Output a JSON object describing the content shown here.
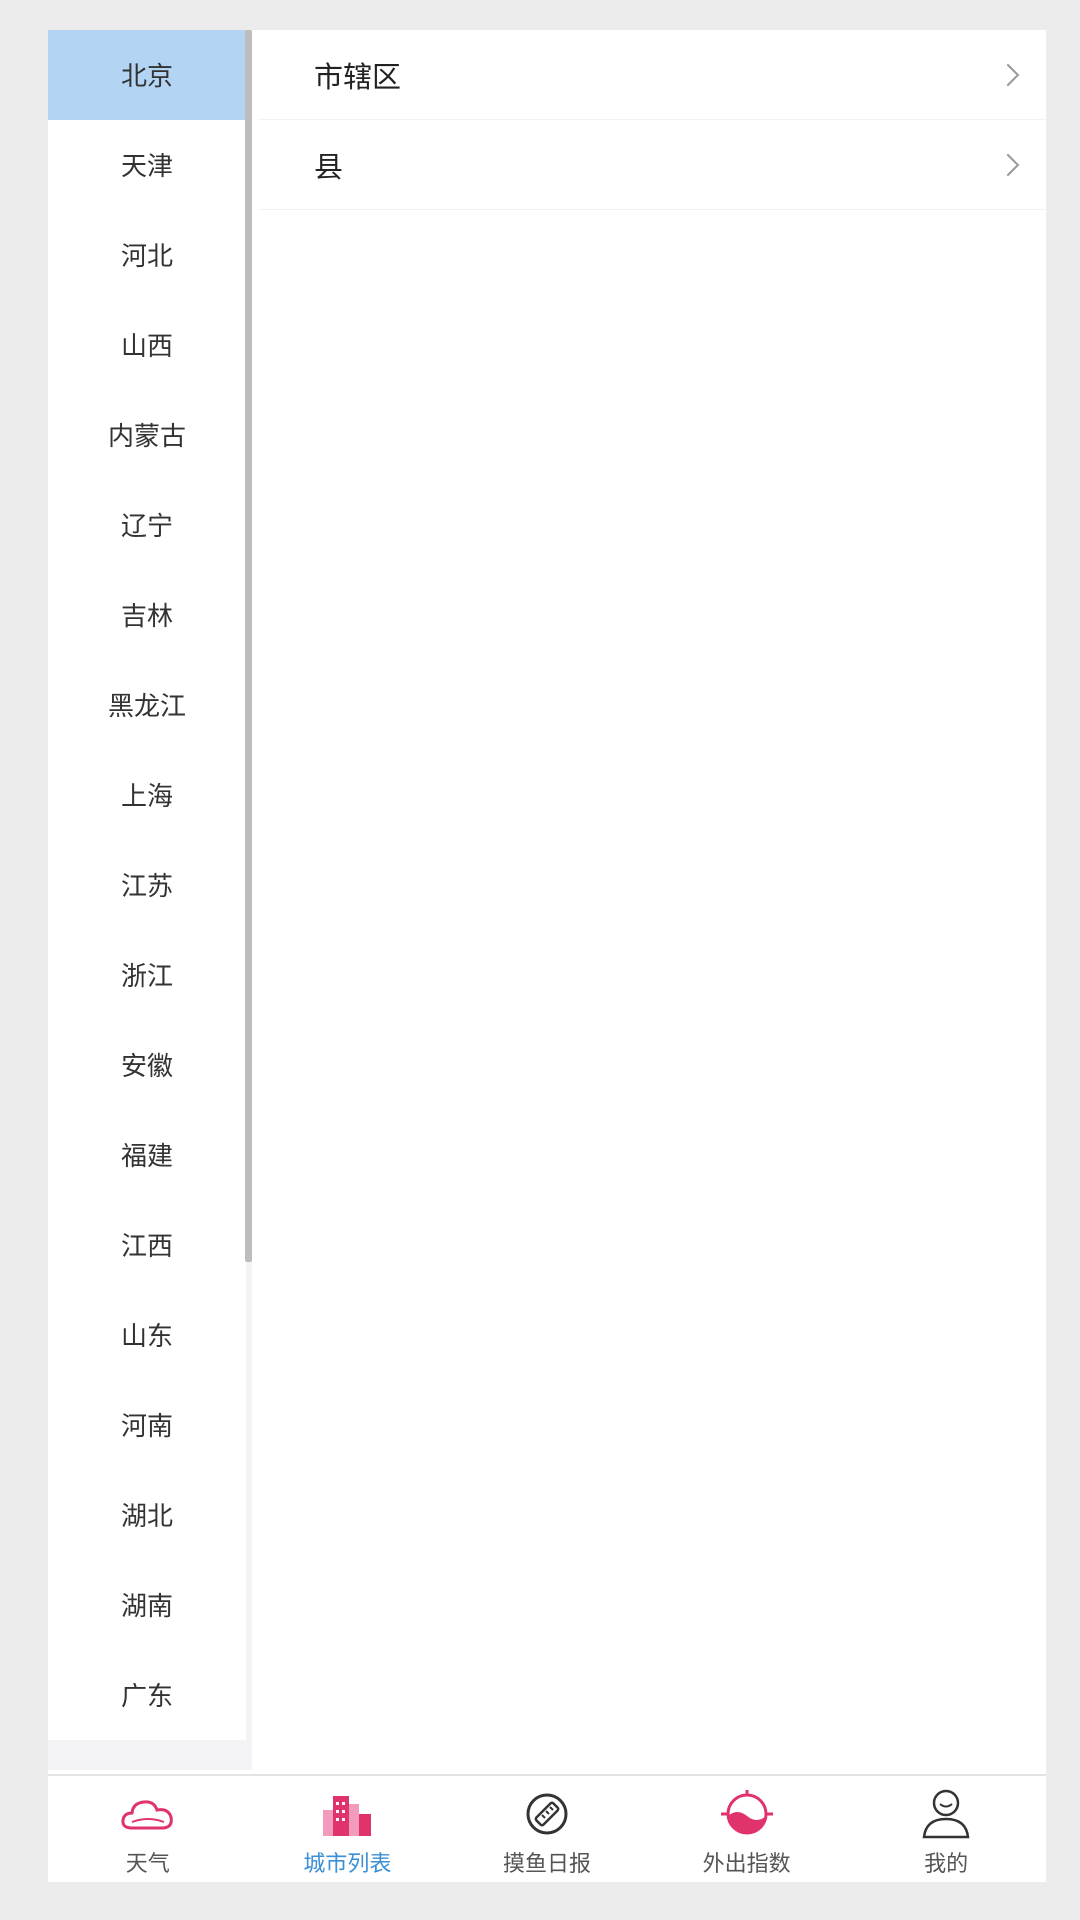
{
  "provinces": [
    {
      "label": "北京",
      "selected": true
    },
    {
      "label": "天津"
    },
    {
      "label": "河北"
    },
    {
      "label": "山西"
    },
    {
      "label": "内蒙古"
    },
    {
      "label": "辽宁"
    },
    {
      "label": "吉林"
    },
    {
      "label": "黑龙江"
    },
    {
      "label": "上海"
    },
    {
      "label": "江苏"
    },
    {
      "label": "浙江"
    },
    {
      "label": "安徽"
    },
    {
      "label": "福建"
    },
    {
      "label": "江西"
    },
    {
      "label": "山东"
    },
    {
      "label": "河南"
    },
    {
      "label": "湖北"
    },
    {
      "label": "湖南"
    },
    {
      "label": "广东"
    }
  ],
  "districts": [
    {
      "label": "市辖区"
    },
    {
      "label": "县"
    }
  ],
  "bottom_nav": [
    {
      "label": "天气",
      "icon": "cloud-icon",
      "active": false
    },
    {
      "label": "城市列表",
      "icon": "city-buildings-icon",
      "active": true
    },
    {
      "label": "摸鱼日报",
      "icon": "ruler-icon",
      "active": false
    },
    {
      "label": "外出指数",
      "icon": "compass-icon",
      "active": false
    },
    {
      "label": "我的",
      "icon": "user-icon",
      "active": false
    }
  ],
  "colors": {
    "selected_background": "#b3d4f2",
    "active_tab_text": "#3a8fd6",
    "icon_pink": "#e0336b"
  }
}
